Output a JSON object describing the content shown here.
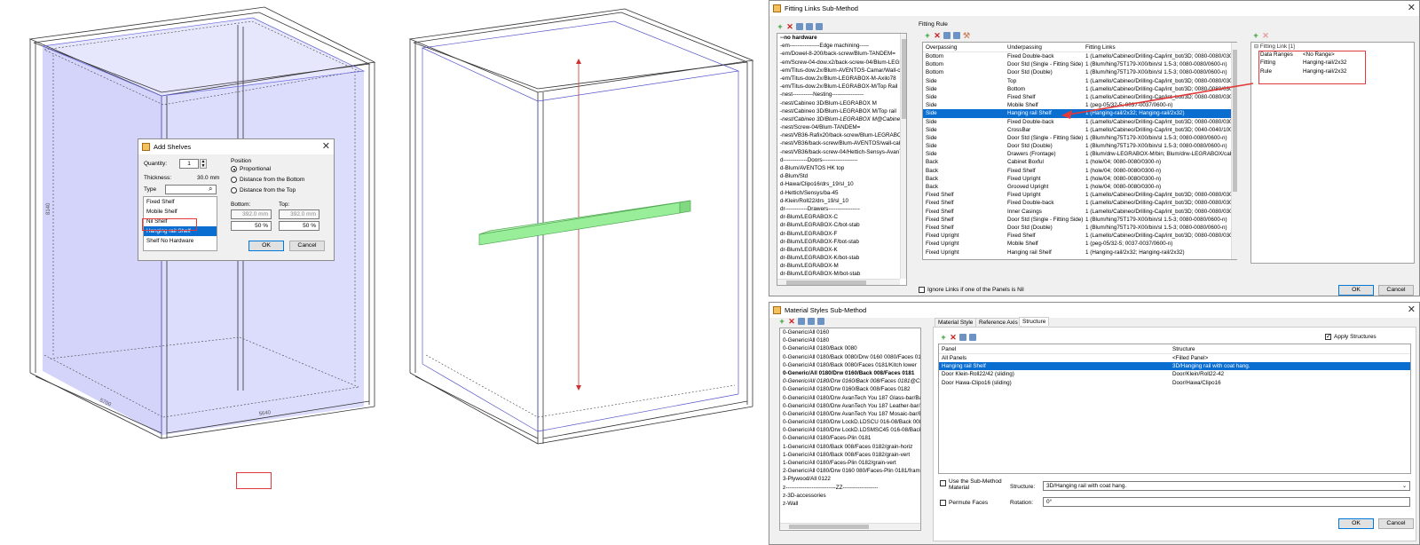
{
  "colors": {
    "accent": "#0a6ed1",
    "highlight": "#e23a3a",
    "cabinet_fill": "#d7d7fb",
    "shelf_green": "#90ee90"
  },
  "left_view": {
    "dim_height": "8140",
    "dim_depth": "5700",
    "dim_width": "5640"
  },
  "add_shelves": {
    "title": "Add Shelves",
    "quantity_label": "Quantity:",
    "quantity_value": "1",
    "thickness_label": "Thickness:",
    "thickness_value": "30.0 mm",
    "type_label": "Type",
    "types": [
      "Fixed Shelf",
      "Mobile Shelf",
      "Nil Shelf",
      "Hanging rail Shelf",
      "Shelf No Hardware"
    ],
    "selected_type": "Hanging rail Shelf",
    "position_label": "Position",
    "options": [
      "Proportional",
      "Distance from the Bottom",
      "Distance from the Top"
    ],
    "bottom_label": "Bottom:",
    "top_label": "Top:",
    "bottom_mm": "392.0 mm",
    "top_mm": "392.0 mm",
    "bottom_pct": "50 %",
    "top_pct": "50 %",
    "ok": "OK",
    "cancel": "Cancel"
  },
  "fitting_links": {
    "title": "Fitting Links Sub-Method",
    "methods": [
      "--no hardware",
      "-em----------------Edge machining-----",
      "-em/Dowel-8-200/back-screw/Blum-TANDEM=",
      "-em/Screw-04-dow.x2/back-screw-04/Blum-LEGRABOX",
      "-em/Titus-dow.2x/Blum-AVENTOS-Camar/Wall-cab",
      "-em/Titus-dow.2x/Blum-LEGRABOX-M-Axilo78",
      "-em/Titus-dow.2x/Blum-LEGRABOX-M/Top Rail",
      "-nest-----------Nesting-----------------",
      "-nest/Cabineo 3D/Blum-LEGRABOX M",
      "-nest/Cabineo 3D/Blum-LEGRABOX M/Top rail",
      "-nest/Cabineo 3D/Blum-LEGRABOX M@Cabinet1",
      "-nest/Screw-04/Blum-TANDEM=",
      "-nest/VB36-Rafix20/back-screw/Blum-LEGRABOX",
      "-nest/VB36/back-screw/Blum-AVENTOS/wall-cab",
      "-nest/VB36/back-screw-04/Hettich-Sensys-AvanTech",
      "d-------------Doors-------------------",
      "d-Blum/AVENTOS HK top",
      "d-Blum/Std",
      "d-Hawa/Clipo16/drs_19/sl_10",
      "d-Hettich/Sensys/ba-45",
      "d-Klein/Roll22/drs_19/sl_10",
      "dr------------Drawers-----------------",
      "dr-Blum/LEGRABOX-C",
      "dr-Blum/LEGRABOX-C/bot-stab",
      "dr-Blum/LEGRABOX-F",
      "dr-Blum/LEGRABOX-F/bot-stab",
      "dr-Blum/LEGRABOX-K",
      "dr-Blum/LEGRABOX-K/bot-stab",
      "dr-Blum/LEGRABOX-M",
      "dr-Blum/LEGRABOX-M/bot-stab"
    ],
    "rule_label": "Fitting Rule",
    "columns": [
      "Overpassing",
      "Underpassing",
      "Fitting Links"
    ],
    "rules": [
      [
        "Bottom",
        "Fixed Double-back",
        "1 (Lamello/Cabineo/Drilling-Cap/int_bot/3D; 0080-0080/0300-r"
      ],
      [
        "Bottom",
        "Door Std (Single - Fitting Side)",
        "1 (Blum/hing75T179-X00/bin/sl 1.5-3; 0080-0080/0600-n)"
      ],
      [
        "Bottom",
        "Door Std (Double)",
        "1 (Blum/hing75T179-X00/bin/sl 1.5-3; 0080-0080/0600-n)"
      ],
      [
        "Side",
        "Top",
        "1 (Lamello/Cabineo/Drilling-Cap/int_bot/3D; 0080-0080/0300-r"
      ],
      [
        "Side",
        "Bottom",
        "1 (Lamello/Cabineo/Drilling-Cap/int_bot/3D; 0080-0080/0300-r"
      ],
      [
        "Side",
        "Fixed Shelf",
        "1 (Lamello/Cabineo/Drilling-Cap/int_bot/3D; 0080-0080/0300-r"
      ],
      [
        "Side",
        "Mobile Shelf",
        "1 (peg-05/32-5; 0037-0037/0600-n)"
      ],
      [
        "Side",
        "Hanging rail Shelf",
        "1 (Hanging-rail/2x32; Hanging-rail/2x32)"
      ],
      [
        "Side",
        "Fixed Double-back",
        "1 (Lamello/Cabineo/Drilling-Cap/int_bot/3D; 0080-0080/0300-r"
      ],
      [
        "Side",
        "CrossBar",
        "1 (Lamello/Cabineo/Drilling-Cap/int_bot/3D; 0040-0040/1000-r"
      ],
      [
        "Side",
        "Door Std (Single - Fitting Side)",
        "1 (Blum/hing75T179-X00/bin/sl 1.5-3; 0080-0080/0600-n)"
      ],
      [
        "Side",
        "Door Std (Double)",
        "1 (Blum/hing75T179-X00/bin/sl 1.5-3; 0080-0080/0600-n)"
      ],
      [
        "Side",
        "Drawers (Frontage)",
        "1 (Blum/drw-LEGRABOX-M/bin; Blum/drw-LEGRABOX/cab-z)"
      ],
      [
        "Back",
        "Cabinet Boxful",
        "1 (hole/04; 0080-0080/0300-n)"
      ],
      [
        "Back",
        "Fixed Shelf",
        "1 (hole/04; 0080-0080/0300-n)"
      ],
      [
        "Back",
        "Fixed Upright",
        "1 (hole/04; 0080-0080/0300-n)"
      ],
      [
        "Back",
        "Grooved Upright",
        "1 (hole/04; 0080-0080/0300-n)"
      ],
      [
        "Fixed Shelf",
        "Fixed Upright",
        "1 (Lamello/Cabineo/Drilling-Cap/int_bot/3D; 0080-0080/0300-r"
      ],
      [
        "Fixed Shelf",
        "Fixed Double-back",
        "1 (Lamello/Cabineo/Drilling-Cap/int_bot/3D; 0080-0080/0300-r"
      ],
      [
        "Fixed Shelf",
        "Inner Casings",
        "1 (Lamello/Cabineo/Drilling-Cap/int_bot/3D; 0080-0080/0300-r"
      ],
      [
        "Fixed Shelf",
        "Door Std (Single - Fitting Side)",
        "1 (Blum/hing75T179-X00/bin/sl 1.5-3; 0080-0080/0600-n)"
      ],
      [
        "Fixed Shelf",
        "Door Std (Double)",
        "1 (Blum/hing75T179-X00/bin/sl 1.5-3; 0080-0080/0600-n)"
      ],
      [
        "Fixed Upright",
        "Fixed Shelf",
        "1 (Lamello/Cabineo/Drilling-Cap/int_bot/3D; 0080-0080/0300-r"
      ],
      [
        "Fixed Upright",
        "Mobile Shelf",
        "1 (peg-05/32-5; 0037-0037/0600-n)"
      ],
      [
        "Fixed Upright",
        "Hanging rail Shelf",
        "1 (Hanging-rail/2x32; Hanging-rail/2x32)"
      ]
    ],
    "selected_rule": 7,
    "link_header": "Fitting Link [1]",
    "props": [
      [
        "Data Ranges",
        "<No Range>"
      ],
      [
        "Fitting",
        "Hanging-rail/2x32"
      ],
      [
        "Rule",
        "Hanging-rail/2x32"
      ]
    ],
    "ignore_label": "Ignore Links if one of the Panels is Nil",
    "ok": "OK",
    "cancel": "Cancel"
  },
  "material_styles": {
    "title": "Material Styles Sub-Method",
    "items": [
      "0-Generic/All 0160",
      "0-Generic/All 0180",
      "0-Generic/All 0180/Back 0080",
      "0-Generic/All 0180/Back 0080/Drw 0160 0080/Faces 0181",
      "0-Generic/All 0180/Back 0080/Faces 0181/Kitch lower",
      "0-Generic/All 0180/Drw 0160/Back 008/Faces 0181",
      "0-Generic/All 0180/Drw 0160/Back 008/Faces 0181@Cabinet",
      "0-Generic/All 0180/Drw 0160/Back 008/Faces 0182",
      "0-Generic/All 0180/Drw AvanTech You 187 Glass-bar/Back 008",
      "0-Generic/All 0180/Drw AvanTech You 187 Leather-bar/Back 008",
      "0-Generic/All 0180/Drw AvanTech You 187 Mosaic-bar/Back 008",
      "0-Generic/All 0180/Drw LockD.LDSCU 016-08/Back 008/Faces",
      "0-Generic/All 0180/Drw LockD.LDSMSC45 016-08/Back 008/",
      "0-Generic/All 0180/Faces-Plin 0181",
      "1-Generic/All 0180/Back 008/Faces 0182/grain-horiz",
      "1-Generic/All 0180/Back 008/Faces 0182/grain-vert",
      "1-Generic/All 0180/Faces-Plin 0182/grain-vert",
      "2-Generic/All 0180/Drw 0160 080/Faces-Plin 0181/framed d",
      "3-Plywood/All 0122",
      "z---------------------------ZZ-------------------",
      "z-3D-accessories",
      "z-Wall"
    ],
    "bold_index": 5,
    "italic_index": 6,
    "tabs": [
      "Material Style",
      "Reference Axis",
      "Structure"
    ],
    "apply_label": "Apply Structures",
    "columns": [
      "Panel",
      "Structure"
    ],
    "rows": [
      [
        "All Panels",
        "<Filled Panel>"
      ],
      [
        "Hanging rail Shelf",
        "3D/Hanging rail with coat hang."
      ],
      [
        "Door Klein-Roll22/42 (sliding)",
        "Door/Klein/Roll22-42"
      ],
      [
        "Door Hawa-Clipo16 (sliding)",
        "Door/Hawa/Clipo16"
      ]
    ],
    "selected_row": 1,
    "use_label": "Use the Sub-Method Material",
    "permute_label": "Permute Faces",
    "structure_label": "Structure:",
    "structure_value": "3D/Hanging rail with coat hang.",
    "rotation_label": "Rotation:",
    "rotation_value": "0°",
    "ok": "OK",
    "cancel": "Cancel"
  }
}
